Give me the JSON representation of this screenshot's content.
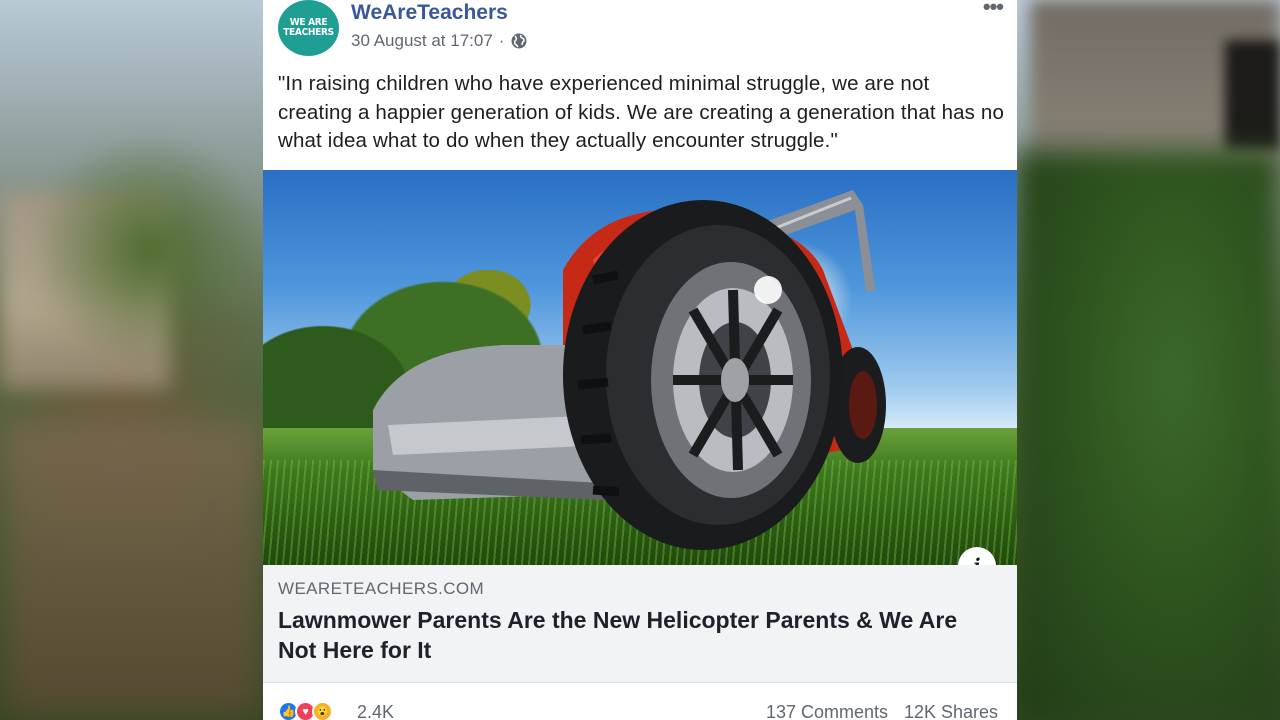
{
  "post": {
    "page_name": "WeAreTeachers",
    "avatar_text_line1": "WE ARE",
    "avatar_text_line2": "TEACHERS",
    "timestamp": "30 August at 17:07",
    "separator": "·",
    "text": "\"In raising children who have experienced minimal struggle, we are not creating a happier generation of kids. We are creating a generation that has no what idea what to do when they actually encounter struggle.\""
  },
  "link_preview": {
    "domain": "WEARETEACHERS.COM",
    "title": "Lawnmower Parents Are the New Helicopter Parents & We Are Not Here for It",
    "info_label": "i"
  },
  "engagement": {
    "reaction_count": "2.4K",
    "comments": "137 Comments",
    "shares": "12K Shares",
    "reactions": [
      "like-icon",
      "love-icon",
      "wow-icon"
    ]
  },
  "colors": {
    "page_name": "#385898",
    "avatar_bg": "#1f9e94",
    "like": "#1877f2",
    "love": "#f33e58",
    "wow": "#f7b125"
  }
}
